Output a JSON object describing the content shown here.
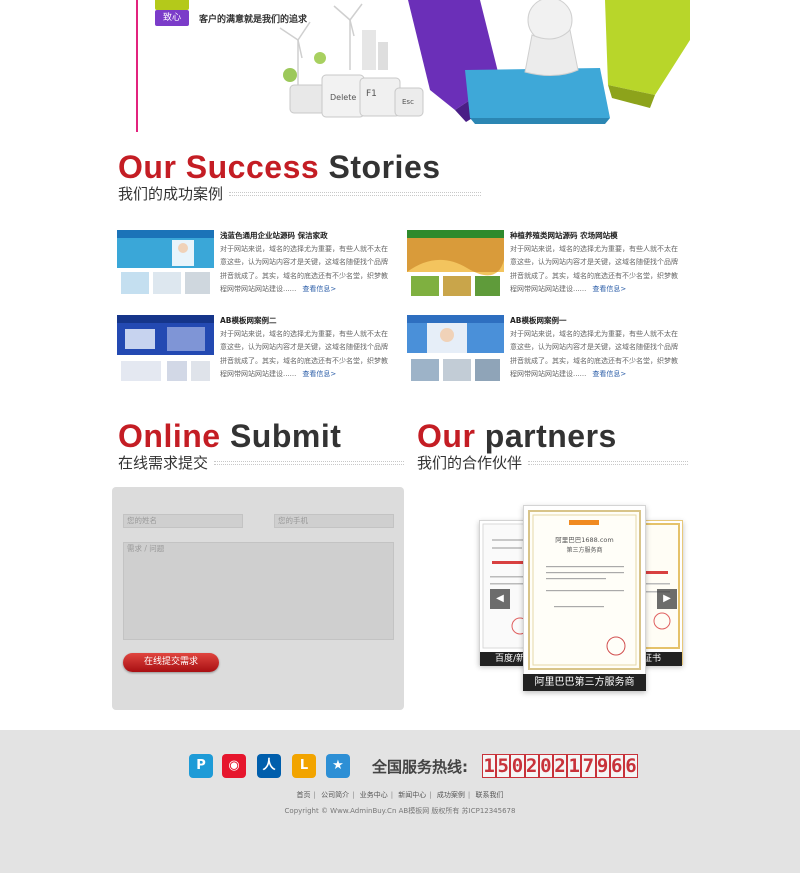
{
  "hero": {
    "badge_top": "",
    "badge_bottom": "致心",
    "slogan": "客户的满意就是我们的追求",
    "keys": [
      "Delete",
      "F1",
      "Esc"
    ]
  },
  "success": {
    "title_red": "Our Success",
    "title_dark": "Stories",
    "subtitle": "我们的成功案例",
    "cases": [
      {
        "title": "浅蓝色通用企业站源码 保洁家政",
        "desc": "对于网站来说，域名的选择尤为重要，有些人就不太在意这些，认为网站内容才是关键，这域名随便找个品牌拼音就成了。其实，域名的底选还有不少名堂，织梦教程网带网站网站建设......",
        "more": "查看信息>"
      },
      {
        "title": "种植养殖类网站源码 农场网站模",
        "desc": "对于网站来说，域名的选择尤为重要，有些人就不太在意这些，认为网站内容才是关键，这域名随便找个品牌拼音就成了。其实，域名的底选还有不少名堂，织梦教程网带网站网站建设......",
        "more": "查看信息>"
      },
      {
        "title": "AB模板网案例二",
        "desc": "对于网站来说，域名的选择尤为重要，有些人就不太在意这些，认为网站内容才是关键，这域名随便找个品牌拼音就成了。其实，域名的底选还有不少名堂，织梦教程网带网站网站建设......",
        "more": "查看信息>"
      },
      {
        "title": "AB模板网案例一",
        "desc": "对于网站来说，域名的选择尤为重要，有些人就不太在意这些，认为网站内容才是关键，这域名随便找个品牌拼音就成了。其实，域名的底选还有不少名堂，织梦教程网带网站网站建设......",
        "more": "查看信息>"
      }
    ]
  },
  "submit": {
    "title_red": "Online",
    "title_dark": "Submit",
    "subtitle": "在线需求提交",
    "name_placeholder": "您的姓名",
    "phone_placeholder": "您的手机",
    "message_placeholder": "需求 / 问题",
    "button": "在线提交需求"
  },
  "partners": {
    "title_red": "Our",
    "title_dark": "partners",
    "subtitle": "我们的合作伙伴",
    "captions": [
      "百度/新",
      "阿里巴巴第三方服务商",
      "证书"
    ],
    "cert_heading": "阿里巴巴1688.com",
    "cert_sub": "第三方服务商",
    "prev": "◀",
    "next": "▶"
  },
  "footer": {
    "hotline_label": "全国服务热线:",
    "hotline_digits": [
      "1",
      "5",
      "0",
      "2",
      "0",
      "2",
      "1",
      "7",
      "9",
      "6",
      "6"
    ],
    "links": [
      "首页",
      "公司简介",
      "业务中心",
      "新闻中心",
      "成功案例",
      "联系我们"
    ],
    "copyright": "Copyright © Www.AdminBuy.Cn AB模板网 版权所有  苏ICP12345678",
    "socials": [
      {
        "name": "p-icon",
        "glyph": "P",
        "color": "#1e9bd7"
      },
      {
        "name": "weibo-icon",
        "glyph": "◉",
        "color": "#e6162d"
      },
      {
        "name": "renren-icon",
        "glyph": "人",
        "color": "#005eac"
      },
      {
        "name": "kaixin-icon",
        "glyph": "L",
        "color": "#f2a400"
      },
      {
        "name": "qzone-icon",
        "glyph": "★",
        "color": "#2d8fd5"
      }
    ]
  }
}
